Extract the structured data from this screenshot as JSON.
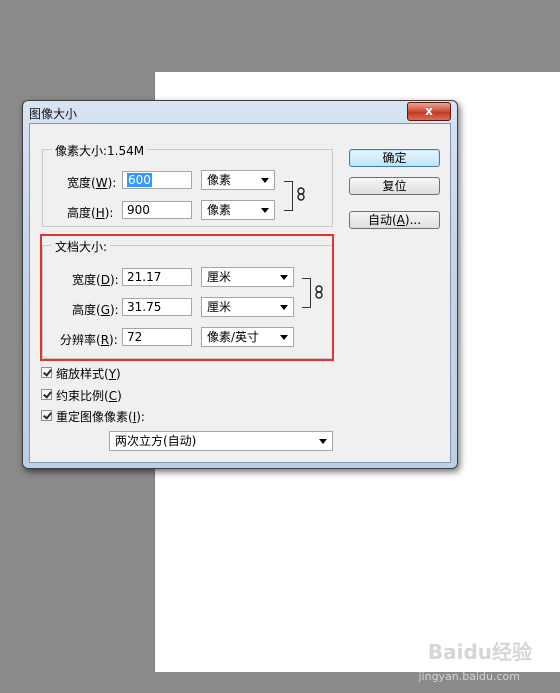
{
  "dialog": {
    "title": "图像大小",
    "close_label": "x"
  },
  "pixel_size": {
    "group_label": "像素大小:1.54M",
    "width_label_pre": "宽度(",
    "width_key": "W",
    "width_label_post": "):",
    "width_value": "600",
    "width_unit": "像素",
    "height_label_pre": "高度(",
    "height_key": "H",
    "height_label_post": "):",
    "height_value": "900",
    "height_unit": "像素"
  },
  "doc_size": {
    "group_label": "文档大小:",
    "width_label_pre": "宽度(",
    "width_key": "D",
    "width_label_post": "):",
    "width_value": "21.17",
    "width_unit": "厘米",
    "height_label_pre": "高度(",
    "height_key": "G",
    "height_label_post": "):",
    "height_value": "31.75",
    "height_unit": "厘米",
    "res_label_pre": "分辨率(",
    "res_key": "R",
    "res_label_post": "):",
    "res_value": "72",
    "res_unit": "像素/英寸"
  },
  "buttons": {
    "ok": "确定",
    "reset": "复位",
    "auto_pre": "自动(",
    "auto_key": "A",
    "auto_post": ")..."
  },
  "options": {
    "scale_styles_pre": "缩放样式(",
    "scale_styles_key": "Y",
    "scale_styles_post": ")",
    "constrain_pre": "约束比例(",
    "constrain_key": "C",
    "constrain_post": ")",
    "resample_pre": "重定图像像素(",
    "resample_key": "I",
    "resample_post": "):",
    "resample_method": "两次立方(自动)"
  },
  "watermark": {
    "logo": "Baidu经验",
    "url": "jingyan.baidu.com"
  },
  "colors": {
    "highlight": "#e53333",
    "selection": "#3399ff"
  }
}
